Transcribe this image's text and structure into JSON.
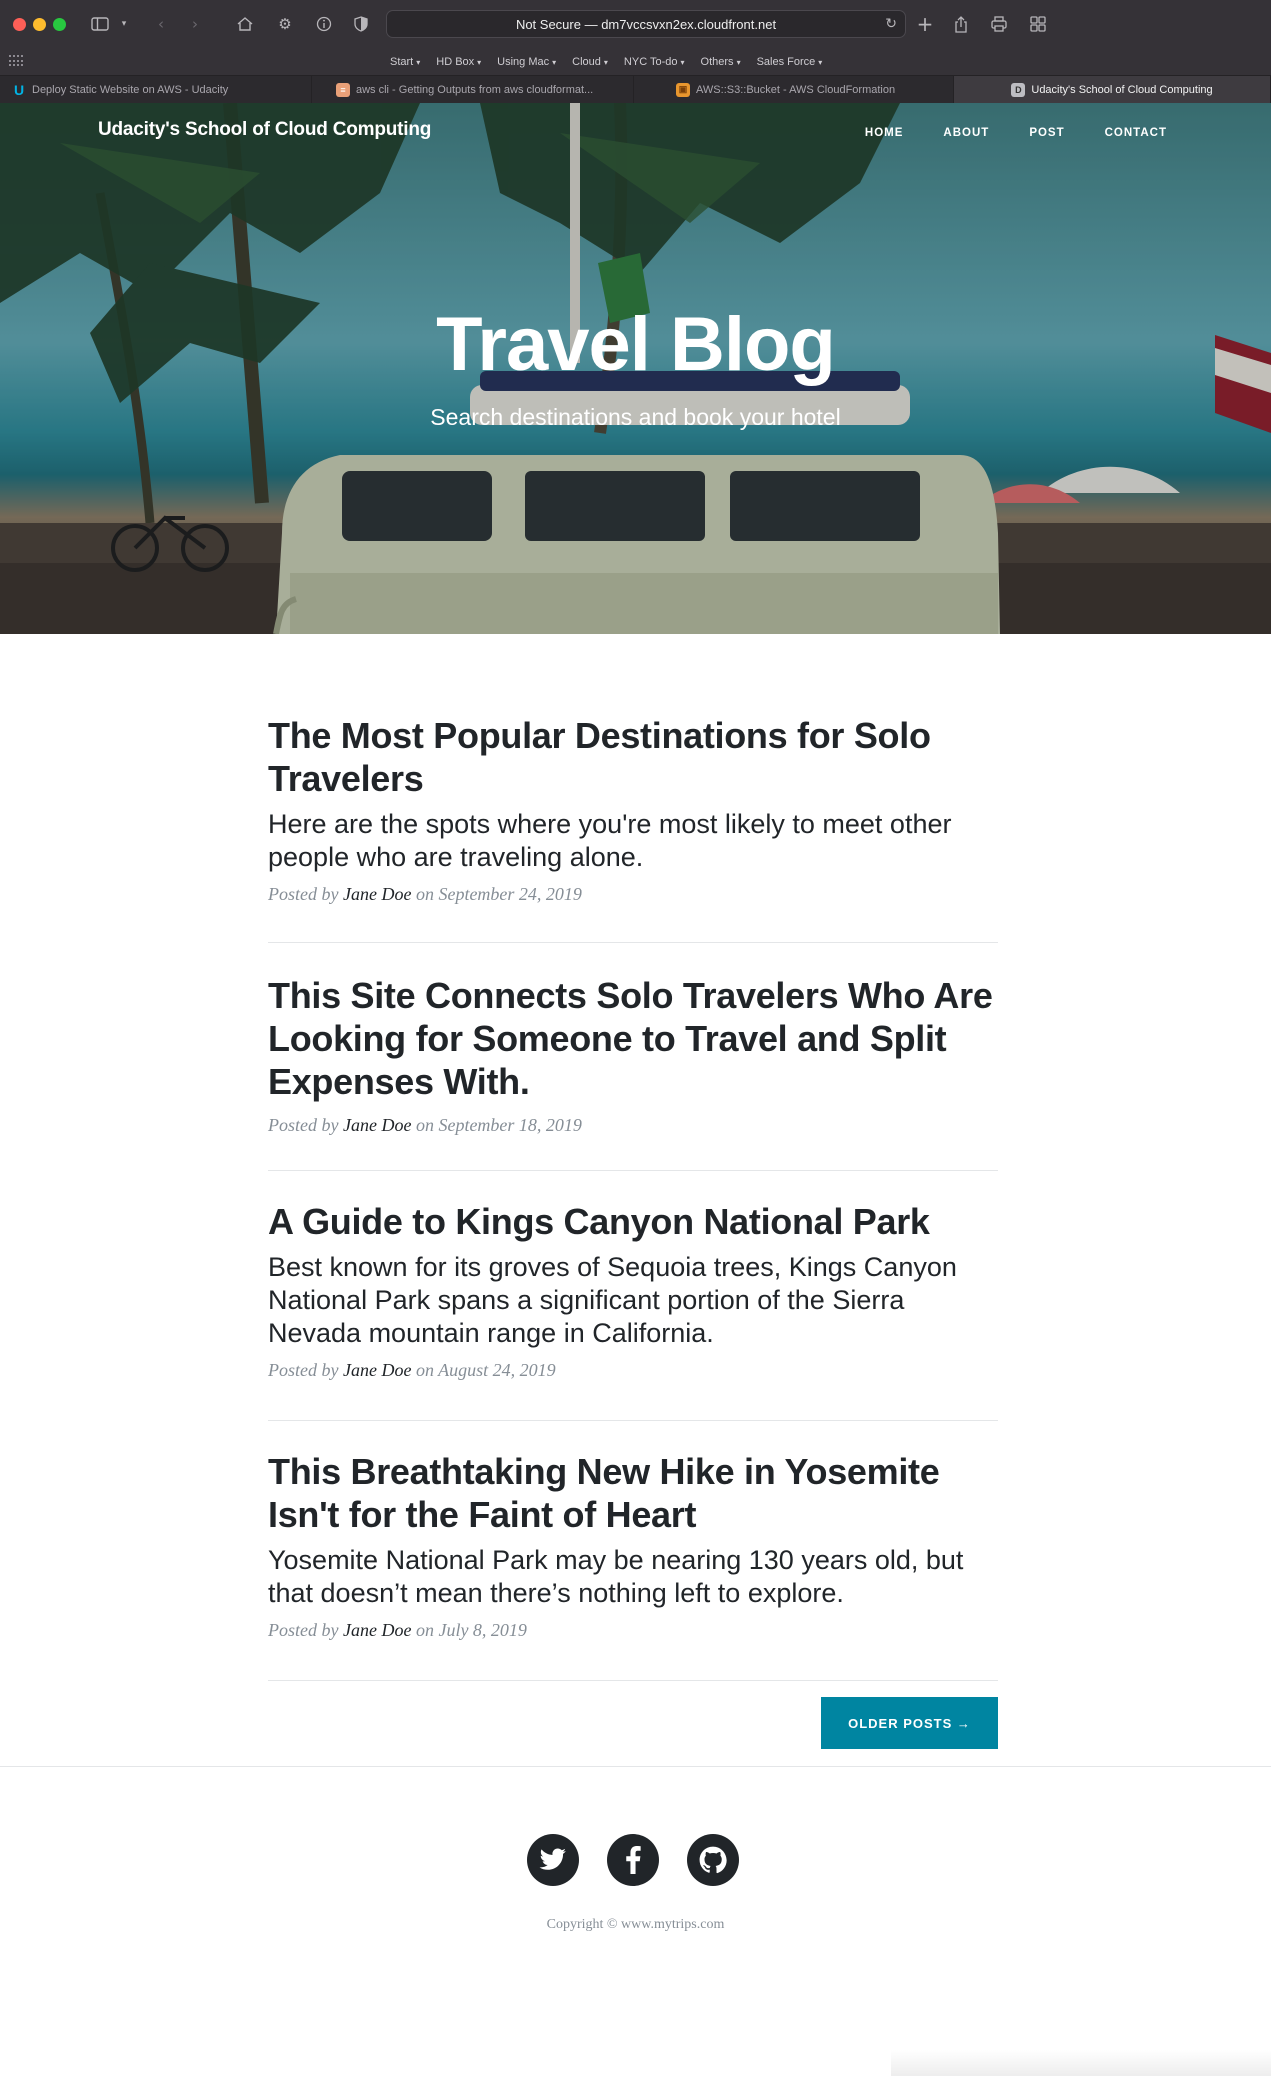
{
  "browser": {
    "address_text": "Not Secure — dm7vccsvxn2ex.cloudfront.net",
    "bookmarks": [
      "Start",
      "HD Box",
      "Using Mac",
      "Cloud",
      "NYC To-do",
      "Others",
      "Sales Force"
    ],
    "tabs": [
      {
        "label": "Deploy Static Website on AWS - Udacity",
        "icon": "udacity-icon"
      },
      {
        "label": "aws cli - Getting Outputs from aws cloudformat...",
        "icon": "stackoverflow-icon"
      },
      {
        "label": "AWS::S3::Bucket - AWS CloudFormation",
        "icon": "aws-icon"
      },
      {
        "label": "Udacity's School of Cloud Computing",
        "icon": "d-letter-icon",
        "active": true
      }
    ]
  },
  "site": {
    "brand": "Udacity's School of Cloud Computing",
    "nav": [
      "Home",
      "About",
      "Post",
      "Contact"
    ],
    "hero_title": "Travel Blog",
    "hero_subtitle": "Search destinations and book your hotel"
  },
  "posts": [
    {
      "title": "The Most Popular Destinations for Solo Travelers",
      "subtitle": "Here are the spots where you're most likely to meet other people who are traveling alone.",
      "meta_prefix": "Posted by",
      "author": "Jane Doe",
      "meta_on": "on",
      "date": "September 24, 2019"
    },
    {
      "title": "This Site Connects Solo Travelers Who Are Looking for Someone to Travel and Split Expenses With.",
      "subtitle": "",
      "meta_prefix": "Posted by",
      "author": "Jane Doe",
      "meta_on": "on",
      "date": "September 18, 2019"
    },
    {
      "title": "A Guide to Kings Canyon National Park",
      "subtitle": "Best known for its groves of Sequoia trees, Kings Canyon National Park spans a significant portion of the Sierra Nevada mountain range in California.",
      "meta_prefix": "Posted by",
      "author": "Jane Doe",
      "meta_on": "on",
      "date": "August 24, 2019"
    },
    {
      "title": "This Breathtaking New Hike in Yosemite Isn't for the Faint of Heart",
      "subtitle": "Yosemite National Park may be nearing 130 years old, but that doesn’t mean there’s nothing left to explore.",
      "meta_prefix": "Posted by",
      "author": "Jane Doe",
      "meta_on": "on",
      "date": "July 8, 2019"
    }
  ],
  "older_posts_label": "Older Posts →",
  "footer": {
    "social": [
      "twitter-icon",
      "facebook-icon",
      "github-icon"
    ],
    "copyright": "Copyright © www.mytrips.com"
  },
  "colors": {
    "accent": "#0085a1",
    "text": "#212529",
    "muted": "#868e96",
    "chrome": "#353237"
  }
}
